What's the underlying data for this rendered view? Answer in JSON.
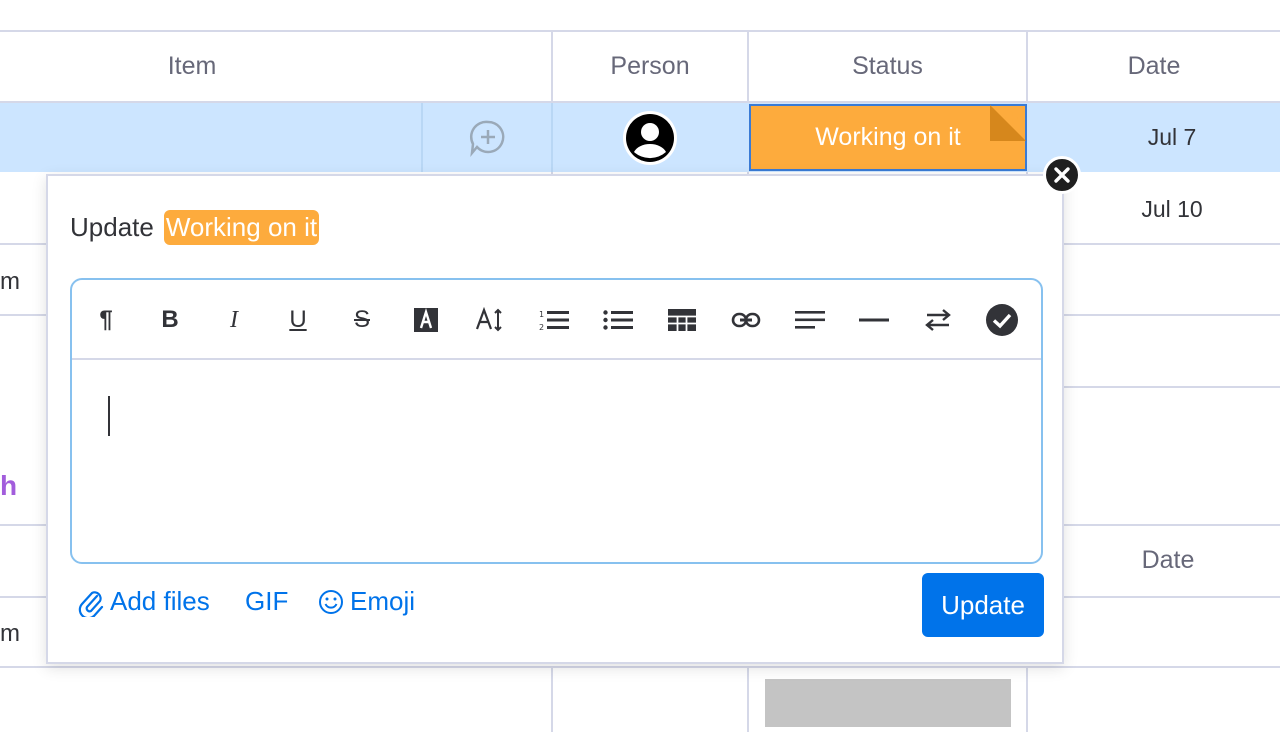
{
  "table": {
    "headers": {
      "item": "Item",
      "person": "Person",
      "status": "Status",
      "date": "Date"
    },
    "rows": [
      {
        "status": "Working on it",
        "date": "Jul 7"
      },
      {
        "date": "Jul 10"
      }
    ],
    "lower_header": {
      "date": "Date"
    },
    "clipped_texts": [
      "m",
      "h",
      "m"
    ]
  },
  "popup": {
    "title_prefix": "Update",
    "title_status": "Working on it",
    "toolbar": [
      {
        "name": "paragraph-icon",
        "glyph": "¶"
      },
      {
        "name": "bold-icon",
        "glyph": "B"
      },
      {
        "name": "italic-icon",
        "glyph": "I"
      },
      {
        "name": "underline-icon",
        "glyph": "U"
      },
      {
        "name": "strikethrough-icon",
        "glyph": "S"
      },
      {
        "name": "text-color-icon",
        "glyph": "A"
      },
      {
        "name": "font-size-icon",
        "glyph": "A↕"
      },
      {
        "name": "numbered-list-icon",
        "glyph": ""
      },
      {
        "name": "bullet-list-icon",
        "glyph": ""
      },
      {
        "name": "table-icon",
        "glyph": ""
      },
      {
        "name": "link-icon",
        "glyph": ""
      },
      {
        "name": "align-icon",
        "glyph": ""
      },
      {
        "name": "divider-icon",
        "glyph": ""
      },
      {
        "name": "direction-icon",
        "glyph": ""
      },
      {
        "name": "checkmark-icon",
        "glyph": ""
      }
    ],
    "footer": {
      "add_files": "Add files",
      "gif": "GIF",
      "emoji": "Emoji",
      "update_button": "Update"
    }
  },
  "colors": {
    "status_working": "#fdab3d",
    "primary": "#0073ea",
    "selected_row": "#cce5ff",
    "purple_text": "#a25ddc"
  }
}
